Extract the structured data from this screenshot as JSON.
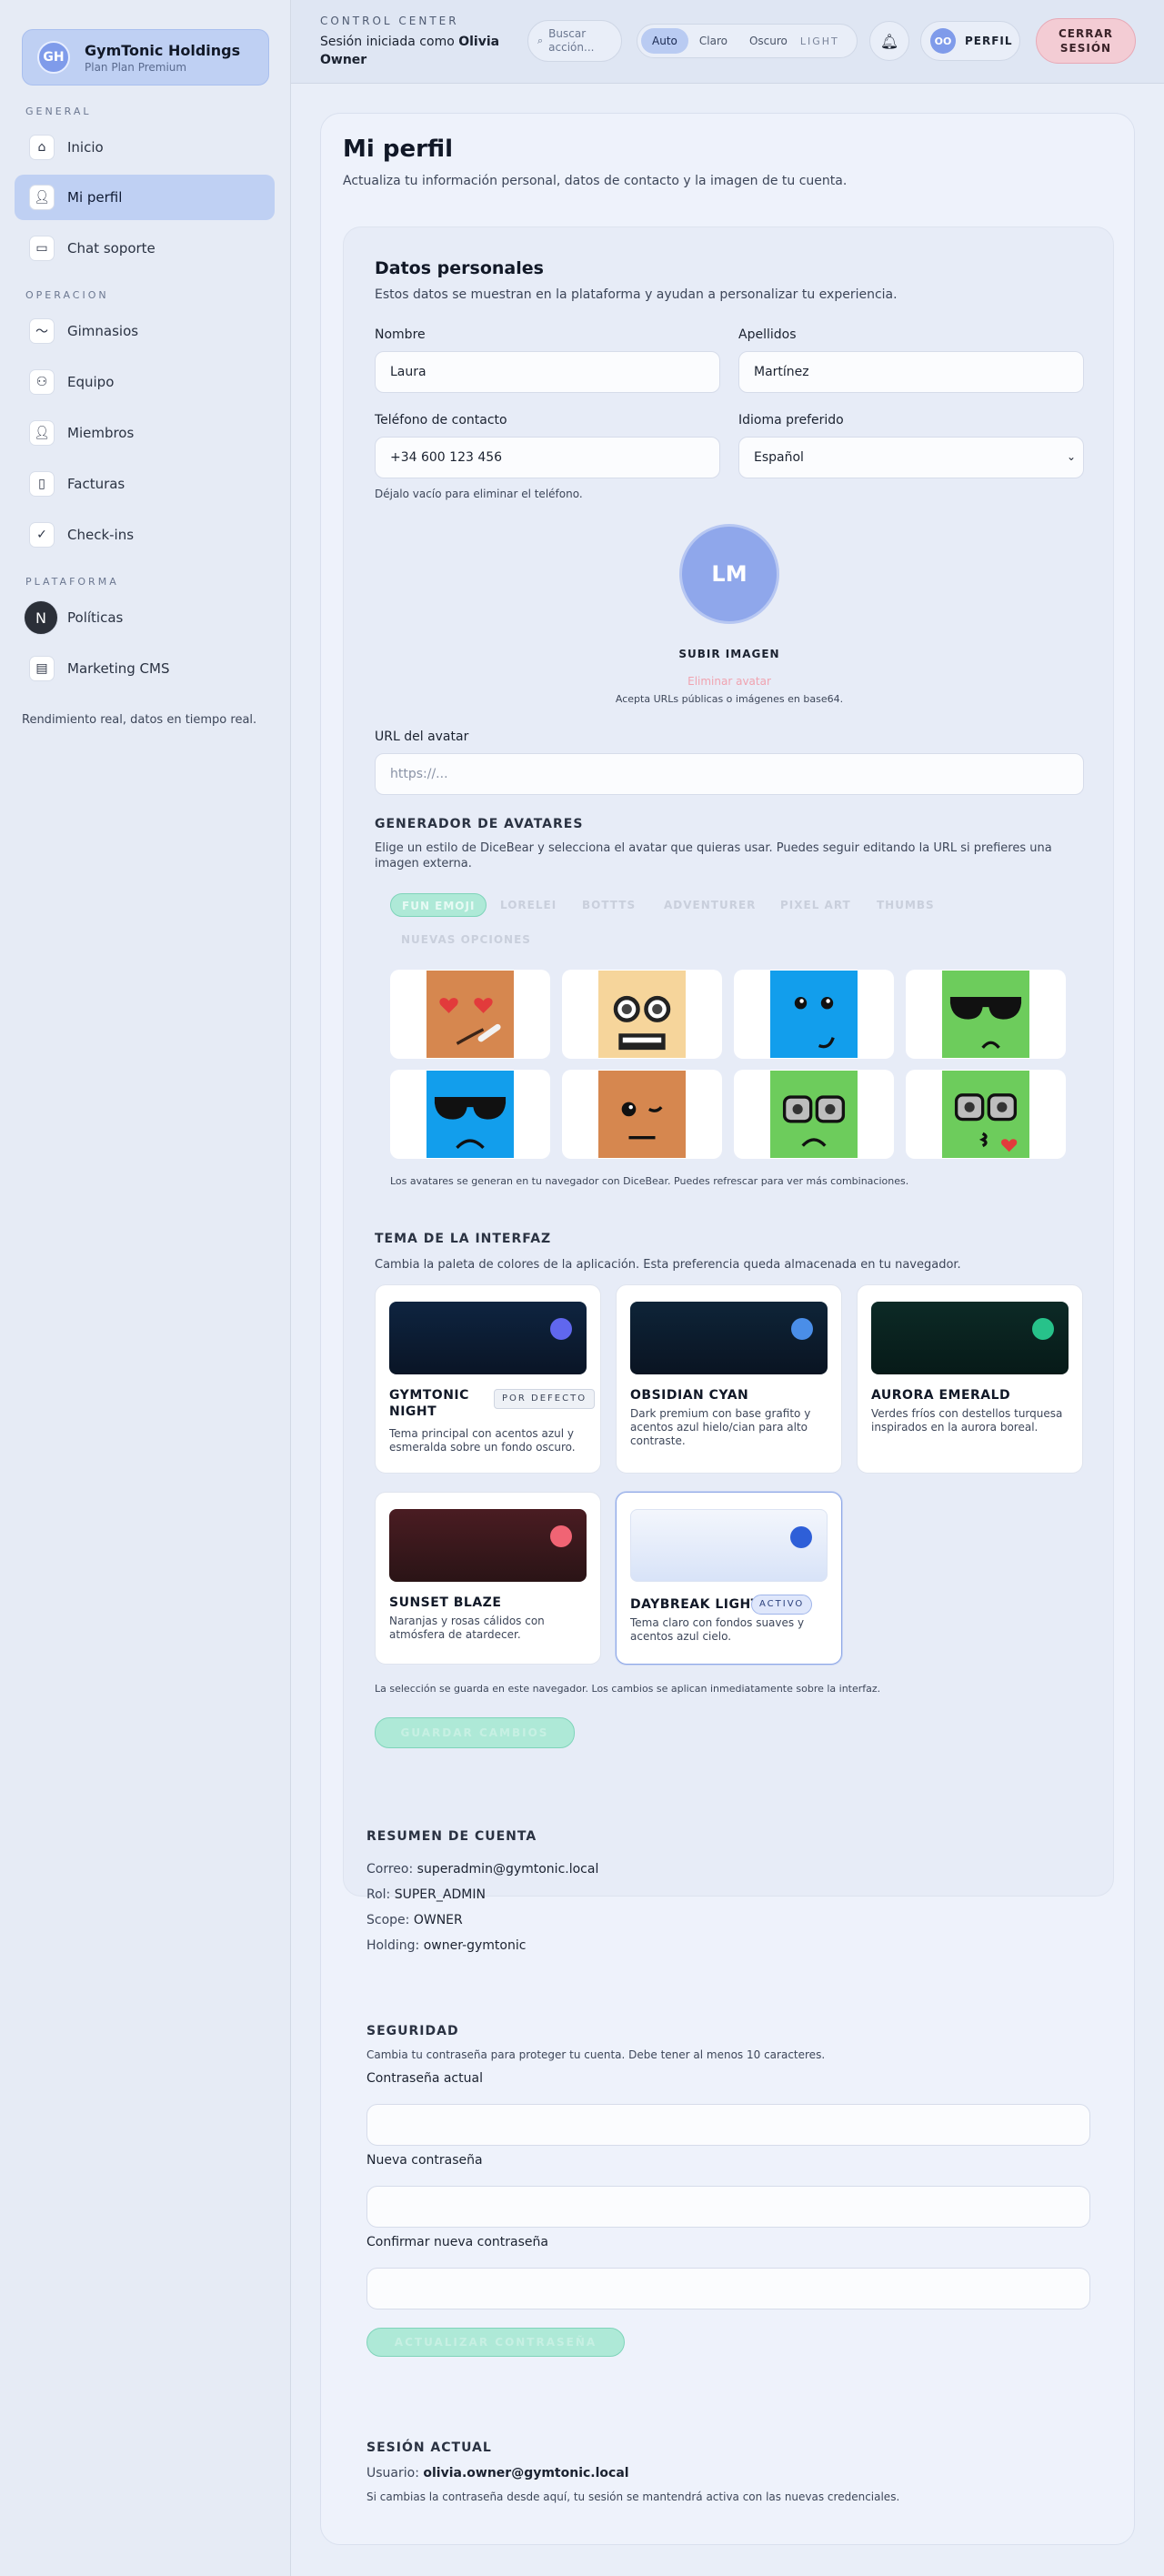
{
  "sidebar": {
    "brand": {
      "initials": "GH",
      "name": "GymTonic Holdings",
      "plan": "Plan Plan Premium"
    },
    "sections": {
      "general": "GENERAL",
      "operacion": "OPERACION",
      "plataforma": "PLATAFORMA"
    },
    "items": [
      {
        "label": "Inicio",
        "icon": "home-icon"
      },
      {
        "label": "Mi perfil",
        "icon": "user-icon"
      },
      {
        "label": "Chat soporte",
        "icon": "chat-icon"
      },
      {
        "label": "Gimnasios",
        "icon": "pulse-icon"
      },
      {
        "label": "Equipo",
        "icon": "team-icon"
      },
      {
        "label": "Miembros",
        "icon": "user-icon"
      },
      {
        "label": "Facturas",
        "icon": "invoice-icon"
      },
      {
        "label": "Check-ins",
        "icon": "check-icon"
      },
      {
        "label": "Políticas",
        "icon": "n-logo-icon"
      },
      {
        "label": "Marketing CMS",
        "icon": "document-icon"
      }
    ],
    "footer": "Rendimiento real, datos en tiempo real."
  },
  "topbar": {
    "title": "CONTROL CENTER",
    "session_prefix": "Sesión iniciada como",
    "session_user": "Olivia Owner",
    "search_placeholder": "Buscar acción...",
    "theme_options": [
      "Auto",
      "Claro",
      "Oscuro"
    ],
    "theme_active": "Auto",
    "theme_current": "LIGHT",
    "profile_initials": "OO",
    "profile_label": "PERFIL",
    "logout_label": "CERRAR SESIÓN"
  },
  "page": {
    "title": "Mi perfil",
    "subtitle": "Actualiza tu información personal, datos de contacto y la imagen de tu cuenta."
  },
  "personal": {
    "title": "Datos personales",
    "subtitle": "Estos datos se muestran en la plataforma y ayudan a personalizar tu experiencia.",
    "first_name_label": "Nombre",
    "first_name": "Laura",
    "last_name_label": "Apellidos",
    "last_name": "Martínez",
    "phone_label": "Teléfono de contacto",
    "phone": "+34 600 123 456",
    "phone_hint": "Déjalo vacío para eliminar el teléfono.",
    "language_label": "Idioma preferido",
    "language": "Español",
    "avatar_initials": "LM",
    "upload_label": "SUBIR IMAGEN",
    "remove_label": "Eliminar avatar",
    "upload_hint": "Acepta URLs públicas o imágenes en base64.",
    "avatar_url_label": "URL del avatar",
    "avatar_url_placeholder": "https://..."
  },
  "generator": {
    "title": "GENERADOR DE AVATARES",
    "description": "Elige un estilo de DiceBear y selecciona el avatar que quieras usar. Puedes seguir editando la URL si prefieres una imagen externa.",
    "tabs": [
      "FUN EMOJI",
      "LORELEI",
      "BOTTTS",
      "ADVENTURER",
      "PIXEL ART",
      "THUMBS",
      "NUEVAS OPCIONES"
    ],
    "active_tab": "FUN EMOJI",
    "avatars": [
      {
        "bg": "#d6874f",
        "icon": "heart-eyes-emoji-icon"
      },
      {
        "bg": "#f6d59b",
        "icon": "nerd-emoji-icon"
      },
      {
        "bg": "#129eec",
        "icon": "wink-emoji-icon"
      },
      {
        "bg": "#6dcc5c",
        "icon": "sunglasses-emoji-icon"
      },
      {
        "bg": "#129eec",
        "icon": "sunglasses-sad-emoji-icon"
      },
      {
        "bg": "#d6874f",
        "icon": "wink-neutral-emoji-icon"
      },
      {
        "bg": "#6dcc5c",
        "icon": "glasses-sad-emoji-icon"
      },
      {
        "bg": "#6dcc5c",
        "icon": "glasses-kiss-emoji-icon"
      }
    ],
    "hint": "Los avatares se generan en tu navegador con DiceBear. Puedes refrescar para ver más combinaciones."
  },
  "theme": {
    "title": "TEMA DE LA INTERFAZ",
    "description": "Cambia la paleta de colores de la aplicación. Esta preferencia queda almacenada en tu navegador.",
    "options": [
      {
        "name": "GYMTONIC NIGHT",
        "badge": "POR DEFECTO",
        "desc": "Tema principal con acentos azul y esmeralda sobre un fondo oscuro.",
        "preview_from": "#0e2440",
        "preview_to": "#0a1526",
        "dot": "#6067ee"
      },
      {
        "name": "OBSIDIAN CYAN",
        "badge": "",
        "desc": "Dark premium con base grafito y acentos azul hielo/cian para alto contraste.",
        "preview_from": "#0e2438",
        "preview_to": "#0a1422",
        "dot": "#4a8ee8"
      },
      {
        "name": "AURORA EMERALD",
        "badge": "",
        "desc": "Verdes fríos con destellos turquesa inspirados en la aurora boreal.",
        "preview_from": "#0c2a26",
        "preview_to": "#071a18",
        "dot": "#27c28a"
      },
      {
        "name": "SUNSET BLAZE",
        "badge": "",
        "desc": "Naranjas y rosas cálidos con atmósfera de atardecer.",
        "preview_from": "#4a1c22",
        "preview_to": "#2a1416",
        "dot": "#f06474"
      },
      {
        "name": "DAYBREAK LIGHT",
        "badge": "ACTIVO",
        "desc": "Tema claro con fondos suaves y acentos azul cielo.",
        "preview_from": "#f3f6fc",
        "preview_to": "#d8e3f8",
        "dot": "#2e5fd8"
      }
    ],
    "hint": "La selección se guarda en este navegador. Los cambios se aplican inmediatamente sobre la interfaz.",
    "save_label": "GUARDAR CAMBIOS"
  },
  "summary": {
    "title": "RESUMEN DE CUENTA",
    "email_label": "Correo:",
    "email": "superadmin@gymtonic.local",
    "role_label": "Rol:",
    "role": "SUPER_ADMIN",
    "scope_label": "Scope:",
    "scope": "OWNER",
    "holding_label": "Holding:",
    "holding": "owner-gymtonic"
  },
  "security": {
    "title": "SEGURIDAD",
    "description": "Cambia tu contraseña para proteger tu cuenta. Debe tener al menos 10 caracteres.",
    "current_label": "Contraseña actual",
    "new_label": "Nueva contraseña",
    "confirm_label": "Confirmar nueva contraseña",
    "submit_label": "ACTUALIZAR CONTRASEÑA"
  },
  "session": {
    "title": "SESIÓN ACTUAL",
    "user_label": "Usuario:",
    "user": "olivia.owner@gymtonic.local",
    "note": "Si cambias la contraseña desde aquí, tu sesión se mantendrá activa con las nuevas credenciales."
  }
}
